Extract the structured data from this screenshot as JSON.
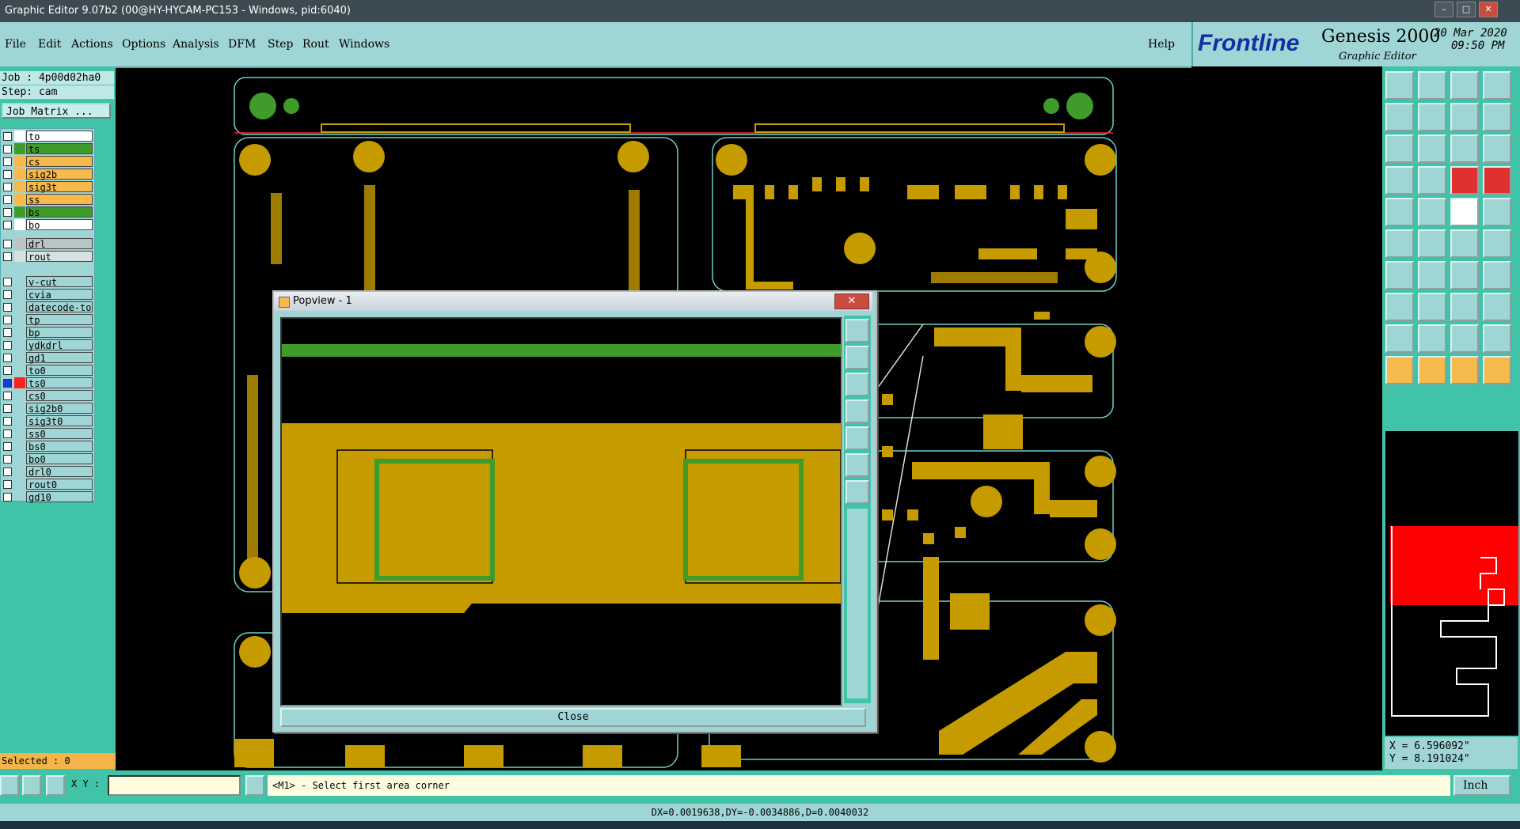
{
  "window": {
    "title": "Graphic Editor 9.07b2 (00@HY-HYCAM-PC153 - Windows, pid:6040)",
    "minimize": "–",
    "maximize": "□",
    "close": "✕"
  },
  "menu": {
    "items": [
      "File",
      "Edit",
      "Actions",
      "Options",
      "Analysis",
      "DFM",
      "Step",
      "Rout",
      "Windows"
    ],
    "help": "Help"
  },
  "logo": {
    "brand": "Frontline",
    "product": "Genesis 2000",
    "subtitle": "Graphic Editor",
    "date": "20 Mar 2020",
    "time": "09:50 PM"
  },
  "job": {
    "job_line": "Job : 4p00d02ha0",
    "step_line": "Step: cam",
    "matrix_button": "Job Matrix ..."
  },
  "layers": [
    {
      "name": "to",
      "color": "#ffffff",
      "checked": false
    },
    {
      "name": "ts",
      "color": "#3f9b2a",
      "checked": false
    },
    {
      "name": "cs",
      "color": "#f6b94c",
      "checked": false
    },
    {
      "name": "sig2b",
      "color": "#f6b94c",
      "checked": false
    },
    {
      "name": "sig3t",
      "color": "#f6b94c",
      "checked": false
    },
    {
      "name": "ss",
      "color": "#f6b94c",
      "checked": false
    },
    {
      "name": "bs",
      "color": "#3f9b2a",
      "checked": false
    },
    {
      "name": "bo",
      "color": "#ffffff",
      "checked": false
    },
    {
      "name": "drl",
      "color": "#b9c4c4",
      "checked": false
    },
    {
      "name": "rout",
      "color": "#d9e0e0",
      "checked": false
    },
    {
      "name": "v-cut",
      "color": "#9fd6d5",
      "checked": false
    },
    {
      "name": "cvia",
      "color": "#9fd6d5",
      "checked": false
    },
    {
      "name": "datecode-to",
      "color": "#9fd6d5",
      "checked": false
    },
    {
      "name": "tp",
      "color": "#9fd6d5",
      "checked": false
    },
    {
      "name": "bp",
      "color": "#9fd6d5",
      "checked": false
    },
    {
      "name": "ydkdrl",
      "color": "#9fd6d5",
      "checked": false
    },
    {
      "name": "gd1",
      "color": "#9fd6d5",
      "checked": false
    },
    {
      "name": "to0",
      "color": "#9fd6d5",
      "checked": false
    },
    {
      "name": "ts0",
      "color": "#9fd6d5",
      "checked": true
    },
    {
      "name": "cs0",
      "color": "#9fd6d5",
      "checked": false
    },
    {
      "name": "sig2b0",
      "color": "#9fd6d5",
      "checked": false
    },
    {
      "name": "sig3t0",
      "color": "#9fd6d5",
      "checked": false
    },
    {
      "name": "ss0",
      "color": "#9fd6d5",
      "checked": false
    },
    {
      "name": "bs0",
      "color": "#9fd6d5",
      "checked": false
    },
    {
      "name": "bo0",
      "color": "#9fd6d5",
      "checked": false
    },
    {
      "name": "drl0",
      "color": "#9fd6d5",
      "checked": false
    },
    {
      "name": "rout0",
      "color": "#9fd6d5",
      "checked": false
    },
    {
      "name": "gd10",
      "color": "#9fd6d5",
      "checked": false
    }
  ],
  "selected": "Selected : 0",
  "status": {
    "xy_label": "X Y :",
    "xy_value": "",
    "prompt": "<M1> - Select first area corner",
    "units": "Inch",
    "measure": "DX=0.0019638,DY=-0.0034886,D=0.0040032"
  },
  "coords": {
    "x": "X = 6.596092\"",
    "y": "Y = 8.191024\""
  },
  "popview": {
    "title": "Popview - 1",
    "close_label": "Close",
    "close_x": "✕"
  },
  "colors": {
    "panel": "#9fd6d5",
    "panel_dark": "#40c3a6",
    "copper": "#c59b00",
    "mask": "#3f9b2a",
    "outline": "#6fd0c8",
    "highlight": "#ff0000"
  }
}
